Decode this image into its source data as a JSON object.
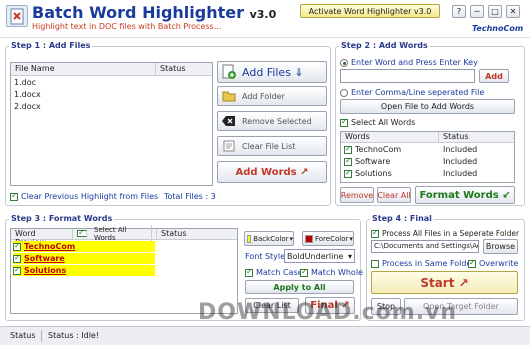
{
  "app": {
    "title": "Batch Word Highlighter",
    "version": "v3.0",
    "subtitle": "Highlight text in DOC files with Batch Process...",
    "activate_label": "Activate Word Highlighter v3.0",
    "brand": "TechnoCom",
    "help_label": "?",
    "minimize_label": "─",
    "close_label": "✕"
  },
  "step1": {
    "title": "Step 1 : Add Files",
    "col_file": "File Name",
    "col_status": "Status",
    "files": [
      {
        "name": "1.doc",
        "status": ""
      },
      {
        "name": "1.docx",
        "status": ""
      },
      {
        "name": "2.docx",
        "status": ""
      }
    ],
    "add_files_label": "Add Files ⇓",
    "add_folder_label": "Add Folder",
    "remove_selected_label": "Remove Selected",
    "clear_list_label": "Clear File List",
    "add_words_label": "Add Words ↗",
    "clear_prev_label": "Clear Previous Highlight from Files",
    "total_files_label": "Total Files : 3"
  },
  "step2": {
    "title": "Step 2 : Add Words",
    "radio_enter_label": "Enter Word and Press Enter Key",
    "word_input_value": "",
    "add_label": "Add",
    "radio_comma_label": "Enter Comma/Line seperated File",
    "open_file_label": "Open File to Add Words",
    "select_all_label": "Select All Words",
    "col_words": "Words",
    "col_status": "Status",
    "words": [
      {
        "word": "TechnoCom",
        "status": "Included"
      },
      {
        "word": "Software",
        "status": "Included"
      },
      {
        "word": "Solutions",
        "status": "Included"
      }
    ],
    "remove_label": "Remove",
    "clear_all_label": "Clear All",
    "format_words_label": "Format Words ↙"
  },
  "step3": {
    "title": "Step 3 : Format Words",
    "col_preview": "Word Preview",
    "select_all_label": "Select All Words",
    "col_status": "Status",
    "words": [
      "TechnoCom",
      "Software",
      "Solutions"
    ],
    "back_color_label": "BackColor",
    "fore_color_label": "ForeColor",
    "font_style_label": "Font Style",
    "font_style_value": "BoldUnderline",
    "match_case_label": "Match Case",
    "match_whole_label": "Match Whole",
    "apply_label": "Apply to All",
    "clear_list_label": "Clear List",
    "final_label": "Final ↗"
  },
  "step4": {
    "title": "Step 4 : Final",
    "process_sep_label": "Process All Files in a Seperate Folder",
    "folder_path": "C:\\Documents and Settings\\Adi\\",
    "browse_label": "Browse",
    "same_folder_label": "Process in Same Folder",
    "overwrite_label": "Overwrite",
    "start_label": "Start ↗",
    "stop_label": "Stop",
    "open_target_label": "Open Target Folder"
  },
  "statusbar": {
    "label": "Status",
    "message": "Status : Idle!"
  },
  "watermark": "DOWNLOAD.com.vn",
  "colors": {
    "title": "#1a3b9c",
    "subtitle": "#c83a1e",
    "highlight_bg": "#ffff00",
    "highlight_fg": "#c00000",
    "brand": "#1a3b9c"
  }
}
